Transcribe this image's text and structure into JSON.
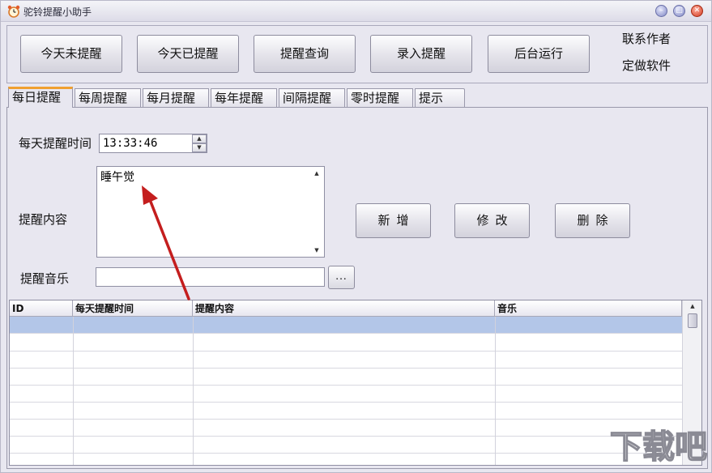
{
  "window": {
    "title": "驼铃提醒小助手"
  },
  "toolbar": {
    "buttons": [
      "今天未提醒",
      "今天已提醒",
      "提醒查询",
      "录入提醒",
      "后台运行"
    ],
    "links": [
      "联系作者",
      "定做软件"
    ]
  },
  "tabs": [
    "每日提醒",
    "每周提醒",
    "每月提醒",
    "每年提醒",
    "间隔提醒",
    "零时提醒",
    "提示"
  ],
  "form": {
    "time_label": "每天提醒时间",
    "time_value": "13:33:46",
    "content_label": "提醒内容",
    "content_value": "睡午觉",
    "music_label": "提醒音乐",
    "music_value": "",
    "browse_label": "..."
  },
  "actions": {
    "add": "新增",
    "edit": "修改",
    "delete": "删除"
  },
  "table": {
    "columns": [
      "ID",
      "每天提醒时间",
      "提醒内容",
      "音乐"
    ],
    "selected_row": 0
  },
  "watermark": {
    "text": "下载吧"
  },
  "colors": {
    "accent_tab": "#f0a030",
    "selection": "#b3c6e8",
    "arrow": "#c41e1e",
    "close_button": "#d2381e"
  }
}
